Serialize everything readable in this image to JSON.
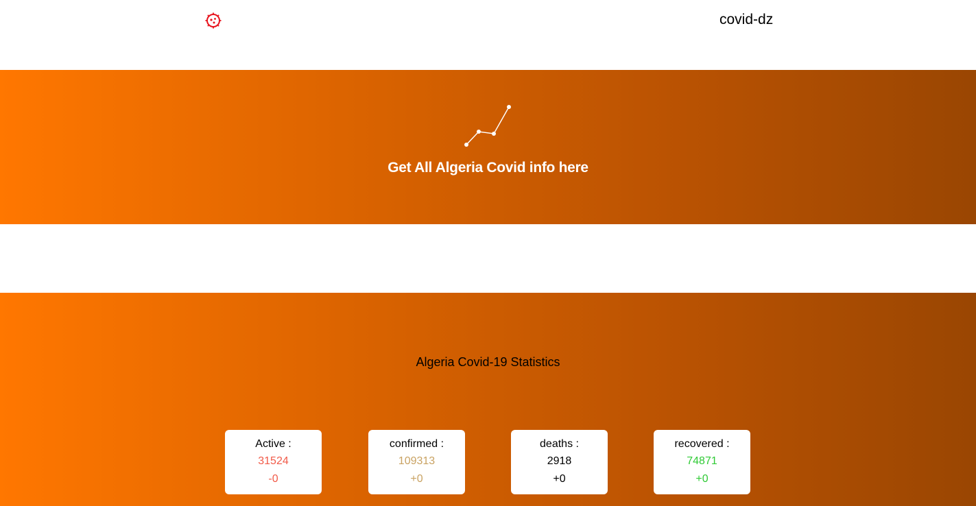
{
  "header": {
    "logo_icon": "virus-icon",
    "brand": "covid-dz"
  },
  "hero": {
    "icon": "line-chart-icon",
    "title": "Get All Algeria Covid info here"
  },
  "stats": {
    "title": "Algeria Covid-19 Statistics",
    "cards": [
      {
        "label": "Active :",
        "value": "31524",
        "delta": "-0",
        "color": "#f15a48"
      },
      {
        "label": "confirmed :",
        "value": "109313",
        "delta": "+0",
        "color": "#c9a262"
      },
      {
        "label": "deaths :",
        "value": "2918",
        "delta": "+0",
        "color": "#000000"
      },
      {
        "label": "recovered :",
        "value": "74871",
        "delta": "+0",
        "color": "#2fca35"
      }
    ]
  },
  "colors": {
    "gradient_start": "#ff7700",
    "gradient_end": "#9a4602",
    "logo": "#e8141e"
  }
}
